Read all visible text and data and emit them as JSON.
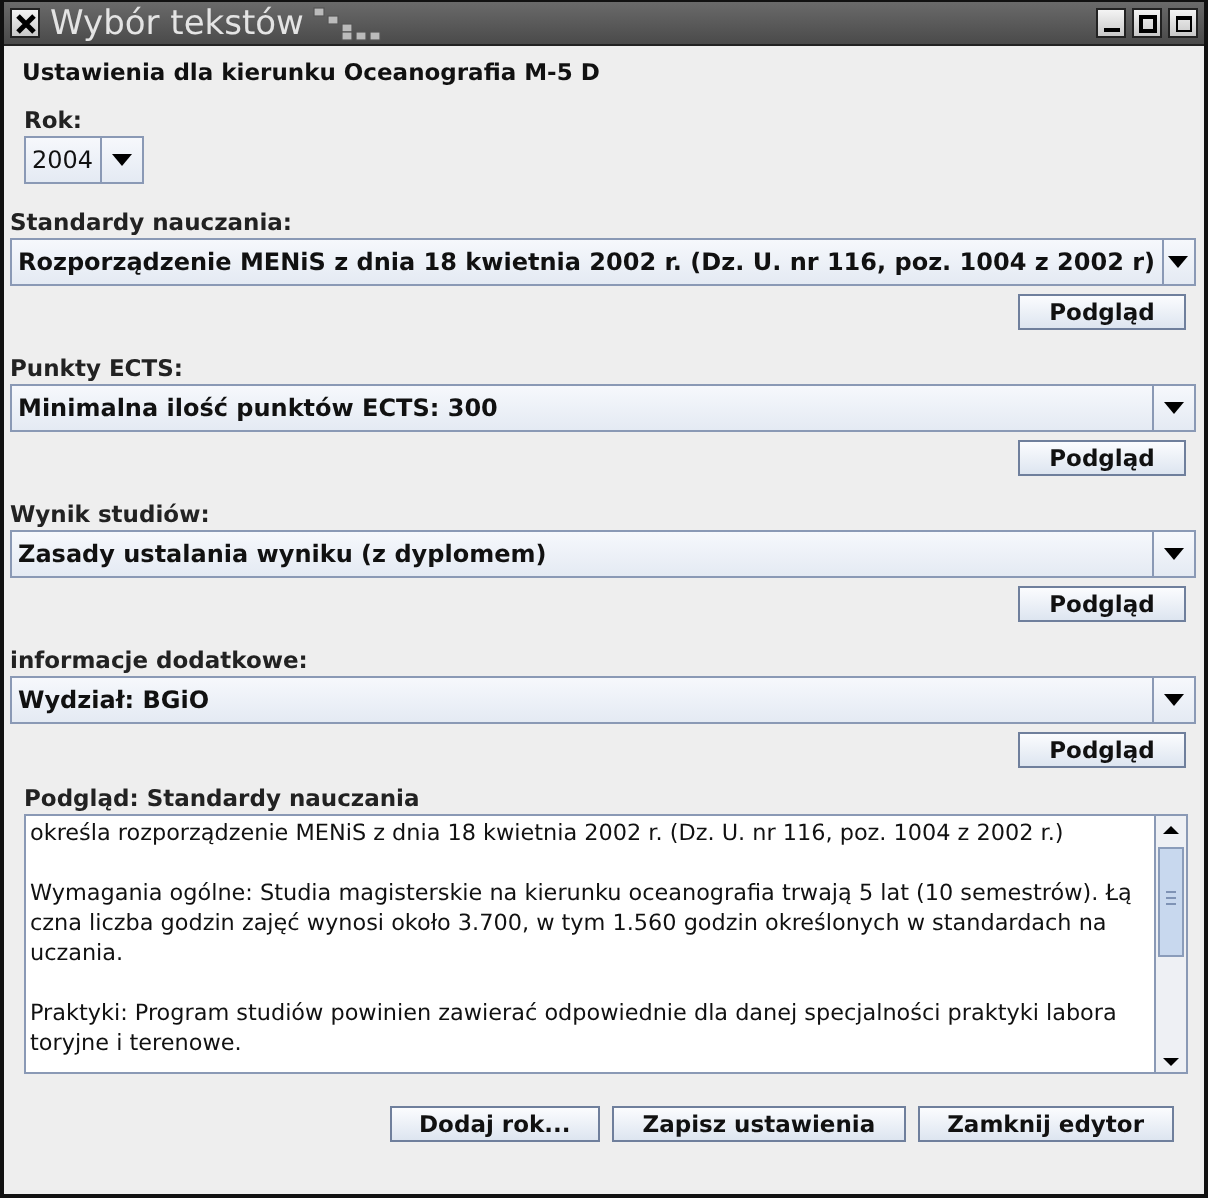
{
  "window": {
    "title": "Wybór tekstów"
  },
  "heading": "Ustawienia dla kierunku Oceanografia M-5 D",
  "year": {
    "label": "Rok:",
    "value": "2004"
  },
  "sections": [
    {
      "label": "Standardy nauczania:",
      "value": "Rozporządzenie MENiS z dnia 18 kwietnia 2002 r. (Dz. U. nr 116, poz. 1004 z 2002 r)",
      "button": "Podgląd"
    },
    {
      "label": "Punkty ECTS:",
      "value": "Minimalna ilość punktów ECTS: 300",
      "button": "Podgląd"
    },
    {
      "label": "Wynik studiów:",
      "value": "Zasady ustalania wyniku (z dyplomem)",
      "button": "Podgląd"
    },
    {
      "label": "informacje dodatkowe:",
      "value": "Wydział: BGiO",
      "button": "Podgląd"
    }
  ],
  "preview": {
    "title": "Podgląd: Standardy nauczania",
    "paragraphs": [
      [
        "określa rozporządzenie MENiS z dnia 18 kwietnia 2002 r. (Dz. U. nr 116, poz. 1004 z 2002 r.)"
      ],
      [
        "Wymagania ogólne: Studia magisterskie na kierunku oceanografia trwają 5 lat (10 semestrów). Łą",
        "czna liczba godzin zajęć wynosi około 3.700, w tym 1.560 godzin określonych w standardach na",
        "uczania."
      ],
      [
        "Praktyki: Program studiów powinien zawierać odpowiednie dla danej specjalności praktyki labora",
        "toryjne i terenowe."
      ]
    ]
  },
  "buttons": [
    "Dodaj rok...",
    "Zapisz ustawienia",
    "Zamknij edytor"
  ]
}
